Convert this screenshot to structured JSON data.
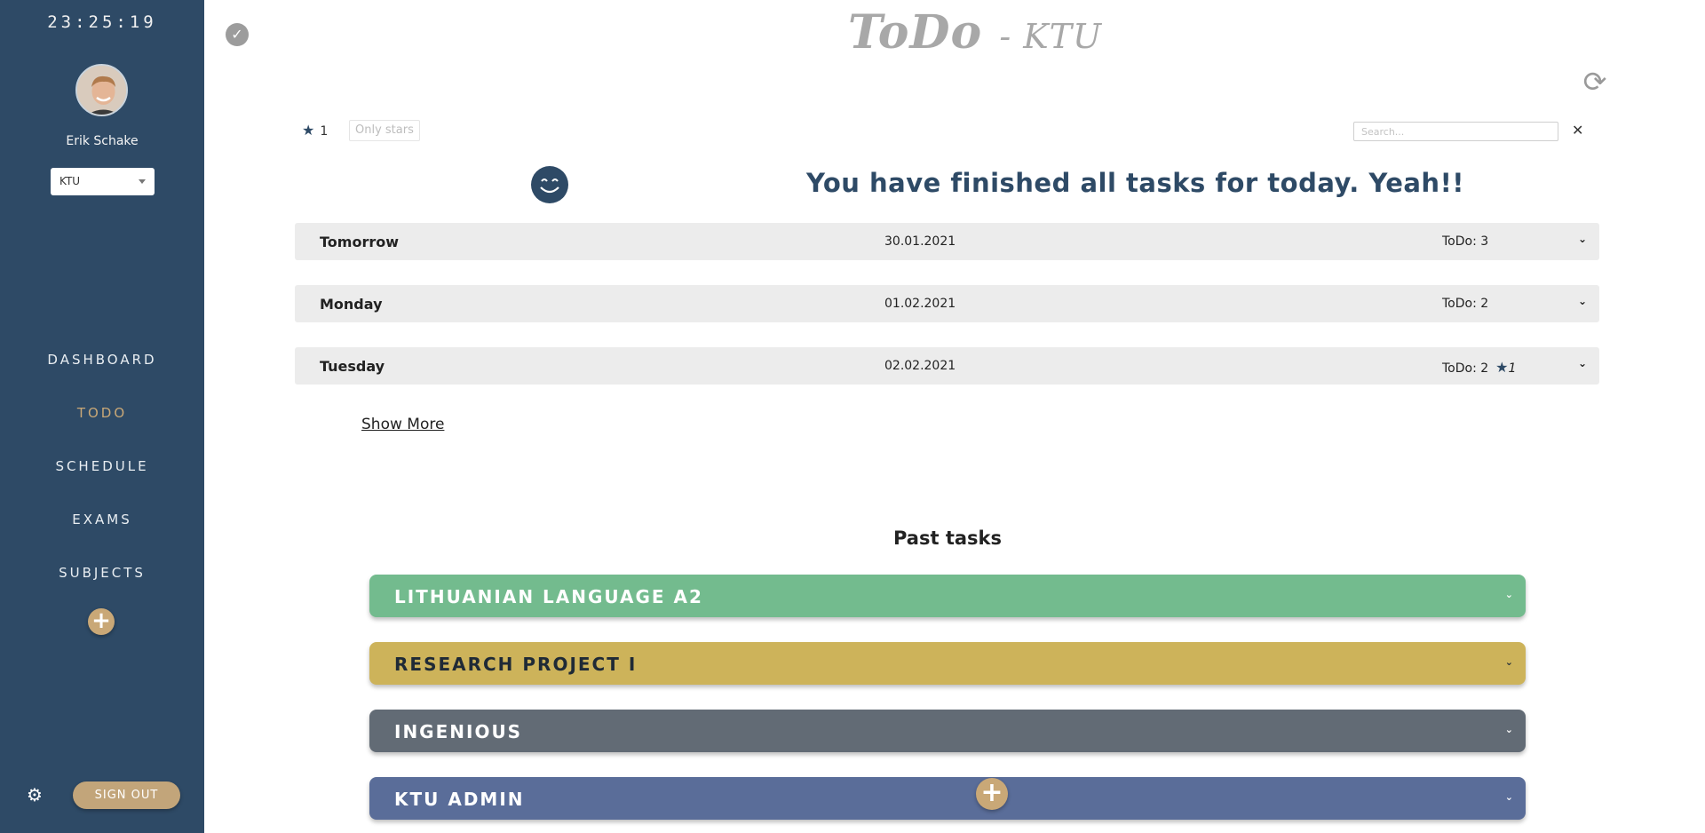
{
  "sidebar": {
    "clock": "23:25:19",
    "user_name": "Erik Schake",
    "org_selected": "KTU",
    "nav": [
      {
        "label": "DASHBOARD"
      },
      {
        "label": "TODO"
      },
      {
        "label": "SCHEDULE"
      },
      {
        "label": "EXAMS"
      },
      {
        "label": "SUBJECTS"
      }
    ],
    "active_nav": "TODO",
    "sign_out_label": "SIGN OUT"
  },
  "header": {
    "title": "ToDo",
    "subtitle": "- KTU"
  },
  "toolbar": {
    "star_count": "1",
    "only_stars_label": "Only stars",
    "search_placeholder": "Search...",
    "clear_label": "✕"
  },
  "status": {
    "message": "You have finished all tasks for today. Yeah!!"
  },
  "upcoming_days": [
    {
      "name": "Tomorrow",
      "date": "30.01.2021",
      "todo": "ToDo: 3",
      "stars": ""
    },
    {
      "name": "Monday",
      "date": "01.02.2021",
      "todo": "ToDo: 2",
      "stars": ""
    },
    {
      "name": "Tuesday",
      "date": "02.02.2021",
      "todo": "ToDo: 2",
      "stars": "1"
    }
  ],
  "show_more_label": "Show More",
  "past": {
    "title": "Past tasks",
    "subjects": [
      {
        "name": "LITHUANIAN LANGUAGE A2",
        "color": "#73bb8e"
      },
      {
        "name": "RESEARCH PROJECT I",
        "color": "#cdb35a"
      },
      {
        "name": "INGENIOUS",
        "color": "#626b75"
      },
      {
        "name": "KTU ADMIN",
        "color": "#5a6d99"
      }
    ]
  },
  "colors": {
    "sidebar": "#2e4a66",
    "accent": "#c9a877",
    "row_bg": "#ececec"
  }
}
